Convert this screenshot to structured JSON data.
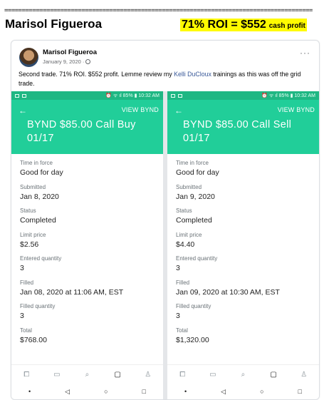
{
  "header": {
    "separator": "========================================================================================",
    "name": "Marisol Figueroa",
    "roi": "71% ROI = $552",
    "roi_suffix": "cash profit"
  },
  "post": {
    "author": "Marisol Figueroa",
    "date": "January 9, 2020 · ",
    "more": "···",
    "caption_before": "Second trade. 71% ROI. $552 profit. Lemme review my ",
    "caption_link": "Kelli DuCloux",
    "caption_after": " trainings as this was off the grid trade."
  },
  "phones": [
    {
      "status_right": "⏰ ᯤ ıl 85% ▮ 10:32 AM",
      "view_link": "VIEW BYND",
      "title": "BYND $85.00 Call Buy 01/17",
      "fields": [
        {
          "label": "Time in force",
          "value": "Good for day"
        },
        {
          "label": "Submitted",
          "value": "Jan 8, 2020"
        },
        {
          "label": "Status",
          "value": "Completed"
        },
        {
          "label": "Limit price",
          "value": "$2.56"
        },
        {
          "label": "Entered quantity",
          "value": "3"
        },
        {
          "label": "Filled",
          "value": "Jan 08, 2020 at 11:06 AM, EST"
        },
        {
          "label": "Filled quantity",
          "value": "3"
        },
        {
          "label": "Total",
          "value": "$768.00"
        }
      ]
    },
    {
      "status_right": "⏰ ᯤ ıl 85% ▮ 10:32 AM",
      "view_link": "VIEW BYND",
      "title": "BYND $85.00 Call Sell 01/17",
      "fields": [
        {
          "label": "Time in force",
          "value": "Good for day"
        },
        {
          "label": "Submitted",
          "value": "Jan 9, 2020"
        },
        {
          "label": "Status",
          "value": "Completed"
        },
        {
          "label": "Limit price",
          "value": "$4.40"
        },
        {
          "label": "Entered quantity",
          "value": "3"
        },
        {
          "label": "Filled",
          "value": "Jan 09, 2020 at 10:30 AM, EST"
        },
        {
          "label": "Filled quantity",
          "value": "3"
        },
        {
          "label": "Total",
          "value": "$1,320.00"
        }
      ]
    }
  ],
  "nav_icons": [
    "chart-icon",
    "card-icon",
    "search-icon",
    "messages-icon",
    "account-icon"
  ],
  "colors": {
    "robinhood_green": "#21ce99",
    "status_green": "#1fb783",
    "highlight": "#fffb00",
    "link": "#385898"
  }
}
